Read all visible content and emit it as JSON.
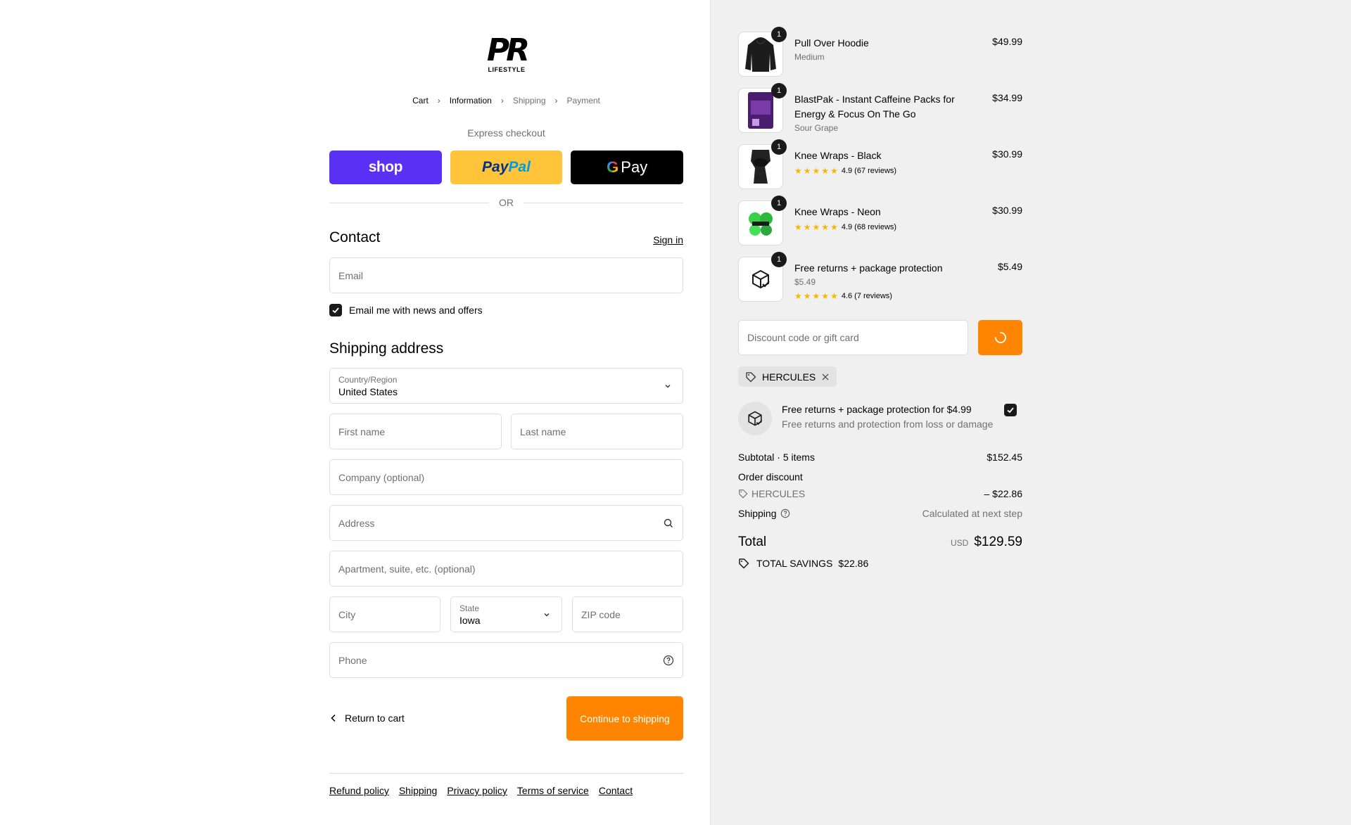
{
  "brand": {
    "logo_main": "PR",
    "logo_sub": "LIFESTYLE"
  },
  "breadcrumb": [
    "Cart",
    "Information",
    "Shipping",
    "Payment"
  ],
  "express": {
    "label": "Express checkout",
    "shop": "shop",
    "paypal_1": "Pay",
    "paypal_2": "Pal",
    "gpay": "Pay",
    "gpay_g": "G"
  },
  "or": "OR",
  "contact": {
    "title": "Contact",
    "signin": "Sign in",
    "email_placeholder": "Email",
    "newsletter": "Email me with news and offers"
  },
  "shipping": {
    "title": "Shipping address",
    "country_label": "Country/Region",
    "country_value": "United States",
    "first_name": "First name",
    "last_name": "Last name",
    "company": "Company (optional)",
    "address": "Address",
    "apartment": "Apartment, suite, etc. (optional)",
    "city": "City",
    "state_label": "State",
    "state_value": "Iowa",
    "zip": "ZIP code",
    "phone": "Phone"
  },
  "actions": {
    "return": "Return to cart",
    "continue": "Continue to shipping"
  },
  "footer": [
    "Refund policy",
    "Shipping",
    "Privacy policy",
    "Terms of service",
    "Contact"
  ],
  "cart": {
    "items": [
      {
        "name": "Pull Over Hoodie",
        "sub": "Medium",
        "price": "$49.99",
        "qty": "1"
      },
      {
        "name": "BlastPak - Instant Caffeine Packs for Energy & Focus On The Go",
        "sub": "Sour Grape",
        "price": "$34.99",
        "qty": "1"
      },
      {
        "name": "Knee Wraps - Black",
        "rating": "4.9 (67 reviews)",
        "price": "$30.99",
        "qty": "1"
      },
      {
        "name": "Knee Wraps - Neon",
        "rating": "4.9 (68 reviews)",
        "price": "$30.99",
        "qty": "1"
      },
      {
        "name": "Free returns + package protection",
        "sub": "$5.49",
        "rating": "4.6 (7 reviews)",
        "price": "$5.49",
        "qty": "1"
      }
    ],
    "discount_placeholder": "Discount code or gift card",
    "applied_code": "HERCULES",
    "protection_title": "Free returns + package protection for $4.99",
    "protection_sub": "Free returns and protection from loss or damage"
  },
  "summary": {
    "subtotal_label": "Subtotal · 5 items",
    "subtotal": "$152.45",
    "order_discount": "Order discount",
    "discount_code": "HERCULES",
    "discount_amount": "– $22.86",
    "shipping_label": "Shipping",
    "shipping_value": "Calculated at next step",
    "total_label": "Total",
    "currency": "USD",
    "total": "$129.59",
    "savings_label": "TOTAL SAVINGS",
    "savings": "$22.86"
  },
  "colors": {
    "accent": "#ff8500",
    "shop": "#5a31f4",
    "paypal": "#ffc439",
    "star": "#f5b800"
  }
}
